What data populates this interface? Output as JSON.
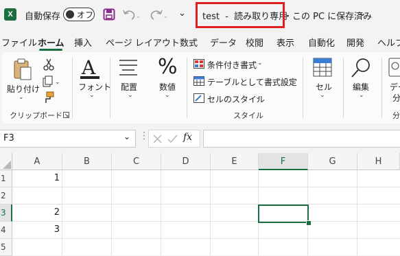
{
  "titlebar": {
    "autosave_label": "自動保存",
    "autosave_state": "オフ",
    "doc_title": "test  -  読み取り専用",
    "save_status": "・この PC に保存済み",
    "more_glyph": "⌄"
  },
  "menu": {
    "tabs": [
      "ファイル",
      "ホーム",
      "挿入",
      "ページ レイアウト",
      "数式",
      "データ",
      "校閲",
      "表示",
      "自動化",
      "開発",
      "ヘルプ"
    ],
    "active_tab": "ホーム"
  },
  "ribbon": {
    "clipboard": {
      "paste_label": "貼り付け",
      "group_label": "クリップボード"
    },
    "font": {
      "label": "フォント"
    },
    "alignment": {
      "label": "配置"
    },
    "number": {
      "label": "数値"
    },
    "styles": {
      "conditional": "条件付き書式",
      "table": "テーブルとして書式設定",
      "cell_styles": "セルのスタイル",
      "group_label": "スタイル"
    },
    "cells": {
      "label": "セル"
    },
    "editing": {
      "label": "編集"
    },
    "data_analysis": {
      "label_line1": "デー",
      "label_line2": "分",
      "group_label": "分"
    }
  },
  "formula_bar": {
    "name_box": "F3",
    "fx": "fx",
    "value": ""
  },
  "sheet": {
    "columns": [
      "A",
      "B",
      "C",
      "D",
      "E",
      "F",
      "G",
      "H"
    ],
    "selected_column": "F",
    "rows": [
      "1",
      "2",
      "3",
      "4",
      "5"
    ],
    "selected_row": "3",
    "cells": {
      "A1": "1",
      "A3": "2",
      "A4": "3"
    },
    "selected_cell": "F3"
  },
  "colors": {
    "accent": "#1d6f42",
    "highlight_box": "#e02020"
  }
}
